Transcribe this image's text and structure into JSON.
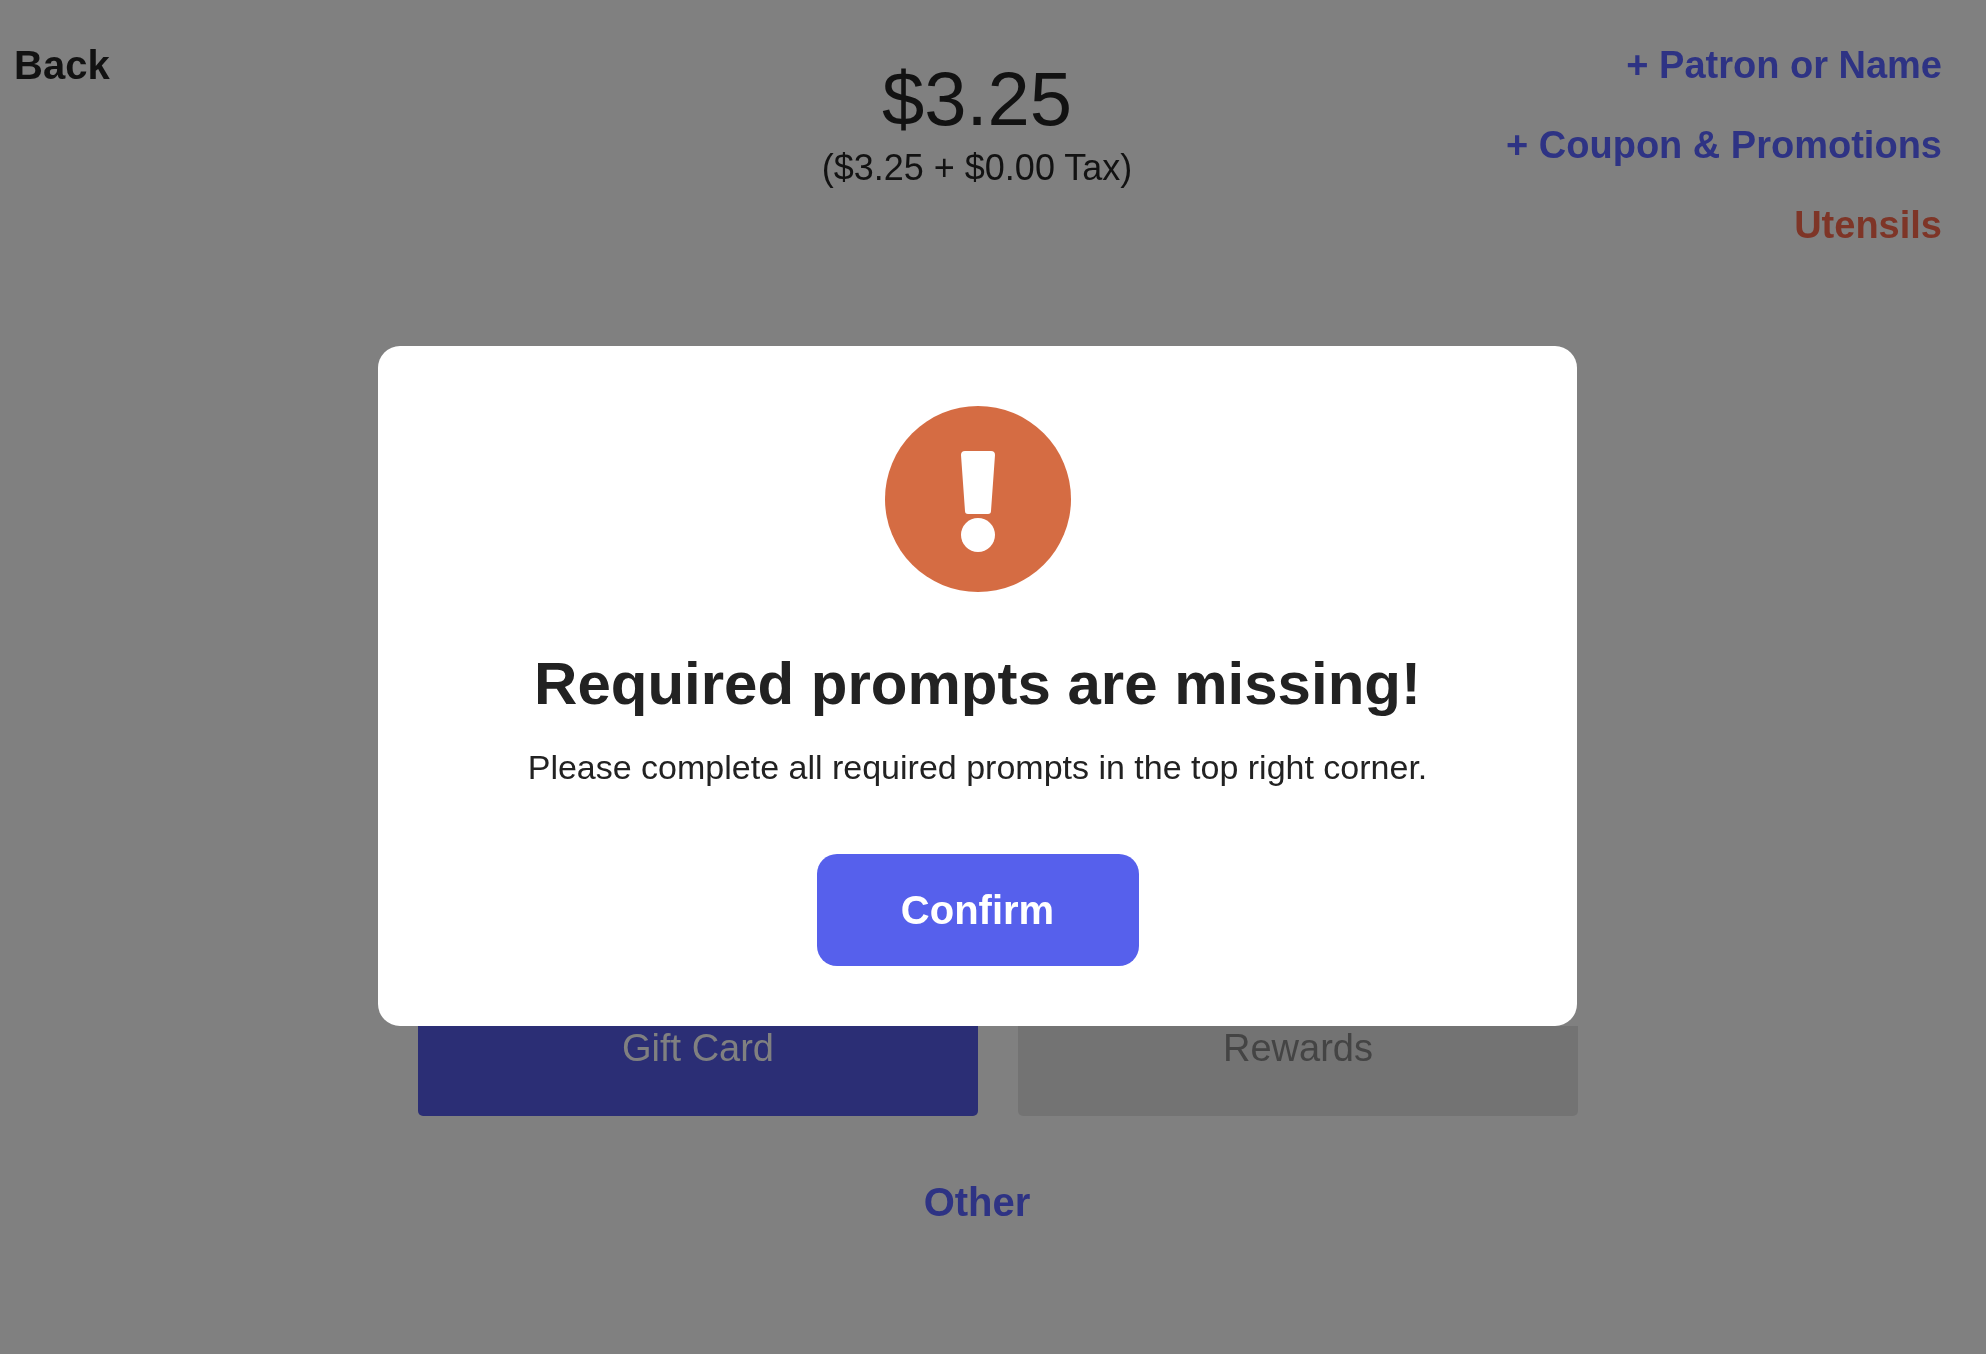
{
  "header": {
    "back": "Back",
    "total": "$3.25",
    "breakdown": "($3.25 + $0.00 Tax)",
    "links": [
      {
        "label": "+ Patron or Name",
        "kind": "add"
      },
      {
        "label": "+ Coupon & Promotions",
        "kind": "add"
      },
      {
        "label": "Utensils",
        "kind": "required"
      }
    ]
  },
  "payment_options": [
    {
      "label": "Gift Card",
      "disabled": false
    },
    {
      "label": "Rewards",
      "disabled": true
    }
  ],
  "other_link": "Other",
  "dialog": {
    "title": "Required prompts are missing!",
    "message": "Please complete all required prompts in the top right corner.",
    "button": "Confirm"
  }
}
